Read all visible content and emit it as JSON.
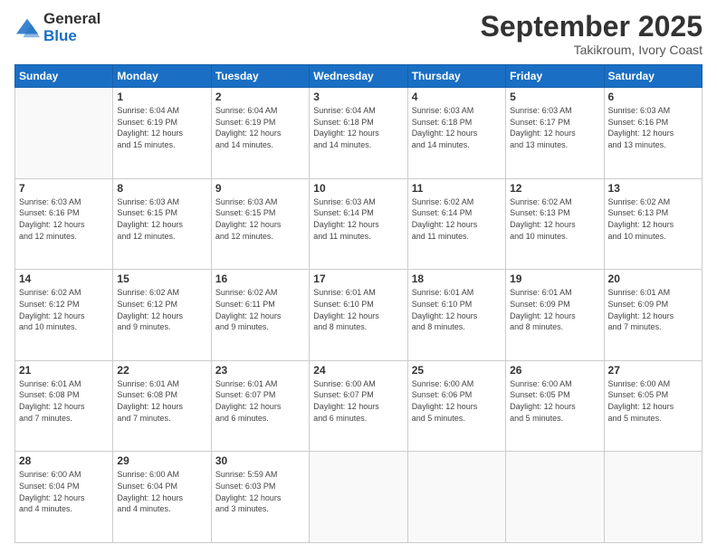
{
  "header": {
    "logo_general": "General",
    "logo_blue": "Blue",
    "month_title": "September 2025",
    "subtitle": "Takikroum, Ivory Coast"
  },
  "weekdays": [
    "Sunday",
    "Monday",
    "Tuesday",
    "Wednesday",
    "Thursday",
    "Friday",
    "Saturday"
  ],
  "weeks": [
    [
      {
        "day": "",
        "info": ""
      },
      {
        "day": "1",
        "info": "Sunrise: 6:04 AM\nSunset: 6:19 PM\nDaylight: 12 hours\nand 15 minutes."
      },
      {
        "day": "2",
        "info": "Sunrise: 6:04 AM\nSunset: 6:19 PM\nDaylight: 12 hours\nand 14 minutes."
      },
      {
        "day": "3",
        "info": "Sunrise: 6:04 AM\nSunset: 6:18 PM\nDaylight: 12 hours\nand 14 minutes."
      },
      {
        "day": "4",
        "info": "Sunrise: 6:03 AM\nSunset: 6:18 PM\nDaylight: 12 hours\nand 14 minutes."
      },
      {
        "day": "5",
        "info": "Sunrise: 6:03 AM\nSunset: 6:17 PM\nDaylight: 12 hours\nand 13 minutes."
      },
      {
        "day": "6",
        "info": "Sunrise: 6:03 AM\nSunset: 6:16 PM\nDaylight: 12 hours\nand 13 minutes."
      }
    ],
    [
      {
        "day": "7",
        "info": "Sunrise: 6:03 AM\nSunset: 6:16 PM\nDaylight: 12 hours\nand 12 minutes."
      },
      {
        "day": "8",
        "info": "Sunrise: 6:03 AM\nSunset: 6:15 PM\nDaylight: 12 hours\nand 12 minutes."
      },
      {
        "day": "9",
        "info": "Sunrise: 6:03 AM\nSunset: 6:15 PM\nDaylight: 12 hours\nand 12 minutes."
      },
      {
        "day": "10",
        "info": "Sunrise: 6:03 AM\nSunset: 6:14 PM\nDaylight: 12 hours\nand 11 minutes."
      },
      {
        "day": "11",
        "info": "Sunrise: 6:02 AM\nSunset: 6:14 PM\nDaylight: 12 hours\nand 11 minutes."
      },
      {
        "day": "12",
        "info": "Sunrise: 6:02 AM\nSunset: 6:13 PM\nDaylight: 12 hours\nand 10 minutes."
      },
      {
        "day": "13",
        "info": "Sunrise: 6:02 AM\nSunset: 6:13 PM\nDaylight: 12 hours\nand 10 minutes."
      }
    ],
    [
      {
        "day": "14",
        "info": "Sunrise: 6:02 AM\nSunset: 6:12 PM\nDaylight: 12 hours\nand 10 minutes."
      },
      {
        "day": "15",
        "info": "Sunrise: 6:02 AM\nSunset: 6:12 PM\nDaylight: 12 hours\nand 9 minutes."
      },
      {
        "day": "16",
        "info": "Sunrise: 6:02 AM\nSunset: 6:11 PM\nDaylight: 12 hours\nand 9 minutes."
      },
      {
        "day": "17",
        "info": "Sunrise: 6:01 AM\nSunset: 6:10 PM\nDaylight: 12 hours\nand 8 minutes."
      },
      {
        "day": "18",
        "info": "Sunrise: 6:01 AM\nSunset: 6:10 PM\nDaylight: 12 hours\nand 8 minutes."
      },
      {
        "day": "19",
        "info": "Sunrise: 6:01 AM\nSunset: 6:09 PM\nDaylight: 12 hours\nand 8 minutes."
      },
      {
        "day": "20",
        "info": "Sunrise: 6:01 AM\nSunset: 6:09 PM\nDaylight: 12 hours\nand 7 minutes."
      }
    ],
    [
      {
        "day": "21",
        "info": "Sunrise: 6:01 AM\nSunset: 6:08 PM\nDaylight: 12 hours\nand 7 minutes."
      },
      {
        "day": "22",
        "info": "Sunrise: 6:01 AM\nSunset: 6:08 PM\nDaylight: 12 hours\nand 7 minutes."
      },
      {
        "day": "23",
        "info": "Sunrise: 6:01 AM\nSunset: 6:07 PM\nDaylight: 12 hours\nand 6 minutes."
      },
      {
        "day": "24",
        "info": "Sunrise: 6:00 AM\nSunset: 6:07 PM\nDaylight: 12 hours\nand 6 minutes."
      },
      {
        "day": "25",
        "info": "Sunrise: 6:00 AM\nSunset: 6:06 PM\nDaylight: 12 hours\nand 5 minutes."
      },
      {
        "day": "26",
        "info": "Sunrise: 6:00 AM\nSunset: 6:05 PM\nDaylight: 12 hours\nand 5 minutes."
      },
      {
        "day": "27",
        "info": "Sunrise: 6:00 AM\nSunset: 6:05 PM\nDaylight: 12 hours\nand 5 minutes."
      }
    ],
    [
      {
        "day": "28",
        "info": "Sunrise: 6:00 AM\nSunset: 6:04 PM\nDaylight: 12 hours\nand 4 minutes."
      },
      {
        "day": "29",
        "info": "Sunrise: 6:00 AM\nSunset: 6:04 PM\nDaylight: 12 hours\nand 4 minutes."
      },
      {
        "day": "30",
        "info": "Sunrise: 5:59 AM\nSunset: 6:03 PM\nDaylight: 12 hours\nand 3 minutes."
      },
      {
        "day": "",
        "info": ""
      },
      {
        "day": "",
        "info": ""
      },
      {
        "day": "",
        "info": ""
      },
      {
        "day": "",
        "info": ""
      }
    ]
  ]
}
